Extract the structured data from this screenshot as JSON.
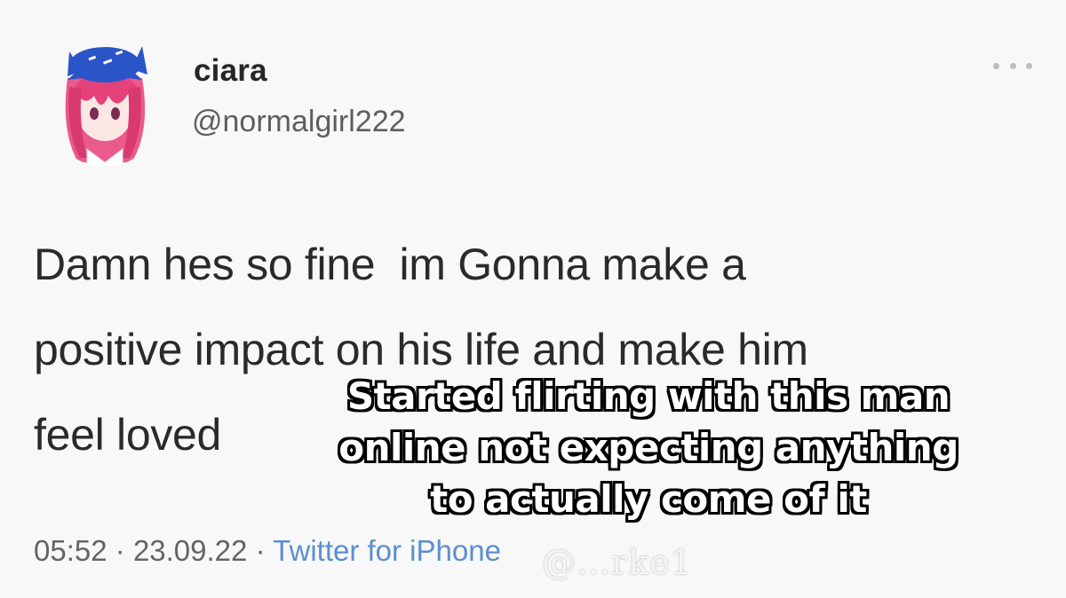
{
  "tweet": {
    "display_name": "ciara",
    "handle": "@normalgirl222",
    "text": "Damn hes so fine  im Gonna make a\npositive impact on his life and make him\nfeel loved",
    "time": "05:52",
    "date": "23.09.22",
    "separator": "·",
    "source": "Twitter for iPhone",
    "more_icon": "more-horizontal-icon"
  },
  "overlay": {
    "caption": "Started flirting with this man online not expecting anything to actually come of it",
    "watermark": "@…rke1"
  },
  "colors": {
    "background": "#f8f8f8",
    "source_link": "#5b8fcf",
    "avatar_hair": "#e5427b",
    "avatar_hat": "#2a55c9"
  }
}
